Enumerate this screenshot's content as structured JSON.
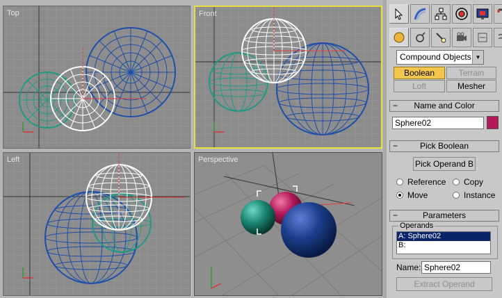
{
  "viewports": {
    "top": "Top",
    "front": "Front",
    "left": "Left",
    "perspective": "Perspective"
  },
  "colors": {
    "active_border": "#e8df3a",
    "sphere_blue": "#1c4fa8",
    "sphere_teal": "#1e9a84",
    "sphere_white": "#ffffff",
    "sphere_magenta": "#c4206a",
    "boolean_active": "#f3c64e"
  },
  "panel": {
    "tabs_row1": [
      "select-icon",
      "create-icon",
      "hierarchy-icon",
      "motion-icon",
      "display-icon",
      "utilities-icon"
    ],
    "tabs_row2": [
      "geometry-icon",
      "shapes-icon",
      "lights-icon",
      "cameras-icon",
      "helpers-icon",
      "spacewarps-icon"
    ],
    "category_dropdown": "Compound Objects",
    "object_type_buttons": [
      {
        "label": "Boolean",
        "state": "active"
      },
      {
        "label": "Terrain",
        "state": "disabled"
      },
      {
        "label": "Loft",
        "state": "disabled"
      },
      {
        "label": "Mesher",
        "state": "normal"
      }
    ],
    "name_and_color": {
      "title": "Name and Color",
      "name": "Sphere02",
      "color": "#b41a5a"
    },
    "pick_boolean": {
      "title": "Pick Boolean",
      "button": "Pick Operand B",
      "options": [
        "Reference",
        "Copy",
        "Move",
        "Instance"
      ],
      "selected": "Move"
    },
    "parameters": {
      "title": "Parameters",
      "operands_label": "Operands",
      "operands": [
        "A: Sphere02",
        "B:"
      ],
      "name_label": "Name:",
      "name_value": "Sphere02",
      "extract_button": "Extract Operand"
    }
  }
}
